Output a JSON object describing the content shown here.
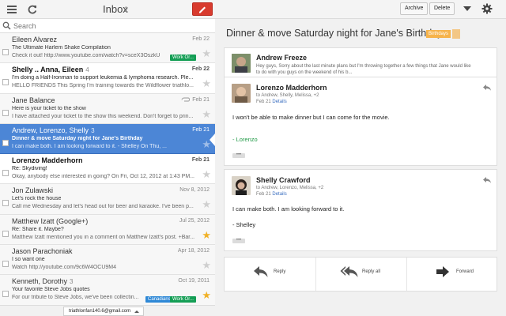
{
  "header": {
    "title": "Inbox",
    "unread_count": "2"
  },
  "search": {
    "placeholder": "Search"
  },
  "threads": [
    {
      "sender": "Eileen Alvarez",
      "count": "",
      "date": "Feb 22",
      "subject": "The Ultimate Harlem Shake Compilation",
      "snippet": "Check it out! http://www.youtube.com/watch?v=sceX3OszkU",
      "label": "Work Or...",
      "starred": false
    },
    {
      "sender": "Shelly .. Anna, Eileen",
      "count": "4",
      "date": "Feb 22",
      "subject": "I'm doing a Half-Ironman to support leukemia & lymphoma research. Ple...",
      "snippet": "HELLO FRIENDS This Spring I'm training towards the Wildflower triathlo...",
      "label": "",
      "starred": false
    },
    {
      "sender": "Jane Balance",
      "count": "",
      "date": "Feb 21",
      "subject": "Here is your ticket to the show",
      "snippet": "I have attached your ticket to the show this weekend. Don't forget to prin...",
      "label": "",
      "starred": false
    },
    {
      "sender": "Andrew, Lorenzo, Shelly",
      "count": "3",
      "date": "Feb 21",
      "subject": "Dinner & move Saturday night for Jane's Birthday",
      "snippet": "I can make both. I am looking forward to it. - Shelley On Thu, ...",
      "label": "",
      "starred": false
    },
    {
      "sender": "Lorenzo Madderhorn",
      "count": "",
      "date": "Feb 21",
      "subject": "Re: Skydiving!",
      "snippet": "Okay, anybody else interested in going? On Fri, Oct 12, 2012 at 1:43 PM...",
      "label": "",
      "starred": false
    },
    {
      "sender": "Jon Zulawski",
      "count": "",
      "date": "Nov 8, 2012",
      "subject": "Let's rock the house",
      "snippet": "Call me Wednesday and let's head out for beer and karaoke. I've been p...",
      "label": "",
      "starred": false
    },
    {
      "sender": "Matthew Izatt (Google+)",
      "count": "",
      "date": "Jul 25, 2012",
      "subject": "Re: Share it. Maybe?",
      "snippet": "Matthew Izatt mentioned you in a comment on Matthew Izatt's post. +Bar...",
      "label": "",
      "starred": true
    },
    {
      "sender": "Jason Parachoniak",
      "count": "",
      "date": "Apr 18, 2012",
      "subject": "I so want one",
      "snippet": "Watch http://youtube.com/9c6W4OCU9M4",
      "label": "",
      "starred": false
    },
    {
      "sender": "Kenneth, Dorothy",
      "count": "3",
      "date": "Oct 19, 2011",
      "subject": "Your favorite Steve Jobs quotes",
      "snippet": "For our tribute to Steve Jobs, we've been collectin...",
      "label": "Work Or...",
      "label2": "Canadians",
      "starred": true
    }
  ],
  "account": {
    "email": "triathlonfan140.6@gmail.com"
  },
  "toolbar": {
    "archive": "Archive",
    "delete": "Delete"
  },
  "conversation": {
    "title": "Dinner & move Saturday night for Jane's Birthday",
    "label": "Birthdays",
    "messages": [
      {
        "name": "Andrew Freeze",
        "preview_1": "Hey guys, Sorry about the last minute plans but I'm throwing together a few things that Jane would like",
        "preview_2": "to do with you guys on the weekend of his b..."
      },
      {
        "name": "Lorenzo Madderhorn",
        "to": "to Andrew, Shelly, Melissa, +2",
        "date": "Feb 21",
        "details": "Details",
        "body": "I won't be able to make dinner but I can come for the movie.",
        "signature": "- Lorenzo",
        "dots": "•••"
      },
      {
        "name": "Shelly Crawford",
        "to": "to Andrew, Lorenzo, Melissa, +2",
        "date": "Feb 21",
        "details": "Details",
        "body": "I can make both. I am looking forward to it.",
        "signature": "- Shelley",
        "dots": "•••"
      }
    ]
  },
  "actions": {
    "reply": "Reply",
    "reply_all": "Reply all",
    "forward": "Forward"
  },
  "colors": {
    "selected_row": "#4c86d6",
    "compose": "#d83b2e",
    "star_on": "#f0b128",
    "chip_work": "#149e55",
    "chip_canvas": "#2e88d6",
    "label_birthdays": "#f6b34b"
  },
  "icons": [
    "menu-icon",
    "refresh-icon",
    "compose-icon",
    "search-icon",
    "star-icon",
    "attachment-icon",
    "more-icon",
    "gear-icon",
    "reply-icon",
    "reply-all-icon",
    "forward-icon"
  ]
}
